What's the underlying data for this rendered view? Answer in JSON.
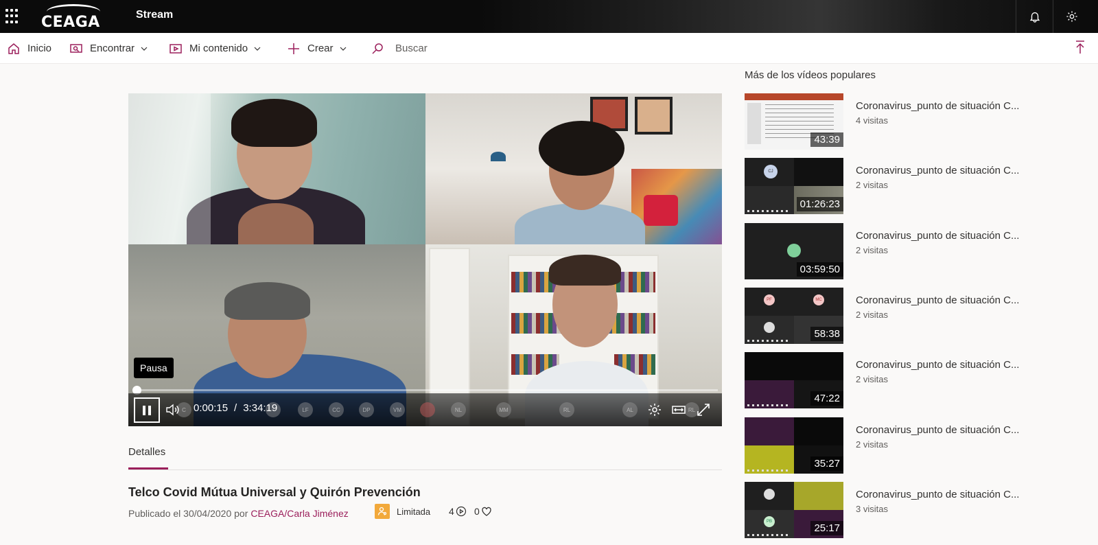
{
  "topbar": {
    "logo_text": "CEAGA",
    "app_title": "Stream"
  },
  "nav": {
    "home": "Inicio",
    "discover": "Encontrar",
    "my_content": "Mi contenido",
    "create": "Crear",
    "search_placeholder": "Buscar"
  },
  "player": {
    "tooltip": "Pausa",
    "current_time": "0:00:15",
    "separator": "/",
    "total_time": "3:34:19",
    "progress": 0.001
  },
  "details": {
    "tab_label": "Detalles",
    "title": "Telco Covid Mútua Universal y Quirón Prevención",
    "published": "Publicado el 30/04/2020 por",
    "author": "CEAGA/Carla Jiménez",
    "permission": "Limitada",
    "views": "4",
    "likes": "0"
  },
  "sidebar": {
    "heading": "Más de los vídeos populares",
    "videos": [
      {
        "title": "Coronavirus_punto de situación C...",
        "views": "4 visitas",
        "duration": "43:39"
      },
      {
        "title": "Coronavirus_punto de situación C...",
        "views": "2 visitas",
        "duration": "01:26:23"
      },
      {
        "title": "Coronavirus_punto de situación C...",
        "views": "2 visitas",
        "duration": "03:59:50"
      },
      {
        "title": "Coronavirus_punto de situación C...",
        "views": "2 visitas",
        "duration": "58:38"
      },
      {
        "title": "Coronavirus_punto de situación C...",
        "views": "2 visitas",
        "duration": "47:22"
      },
      {
        "title": "Coronavirus_punto de situación C...",
        "views": "2 visitas",
        "duration": "35:27"
      },
      {
        "title": "Coronavirus_punto de situación C...",
        "views": "3 visitas",
        "duration": "25:17"
      }
    ]
  },
  "colors": {
    "accent": "#9b1f5b",
    "topbar": "#0b0b0b",
    "badge": "#f2a93b"
  }
}
